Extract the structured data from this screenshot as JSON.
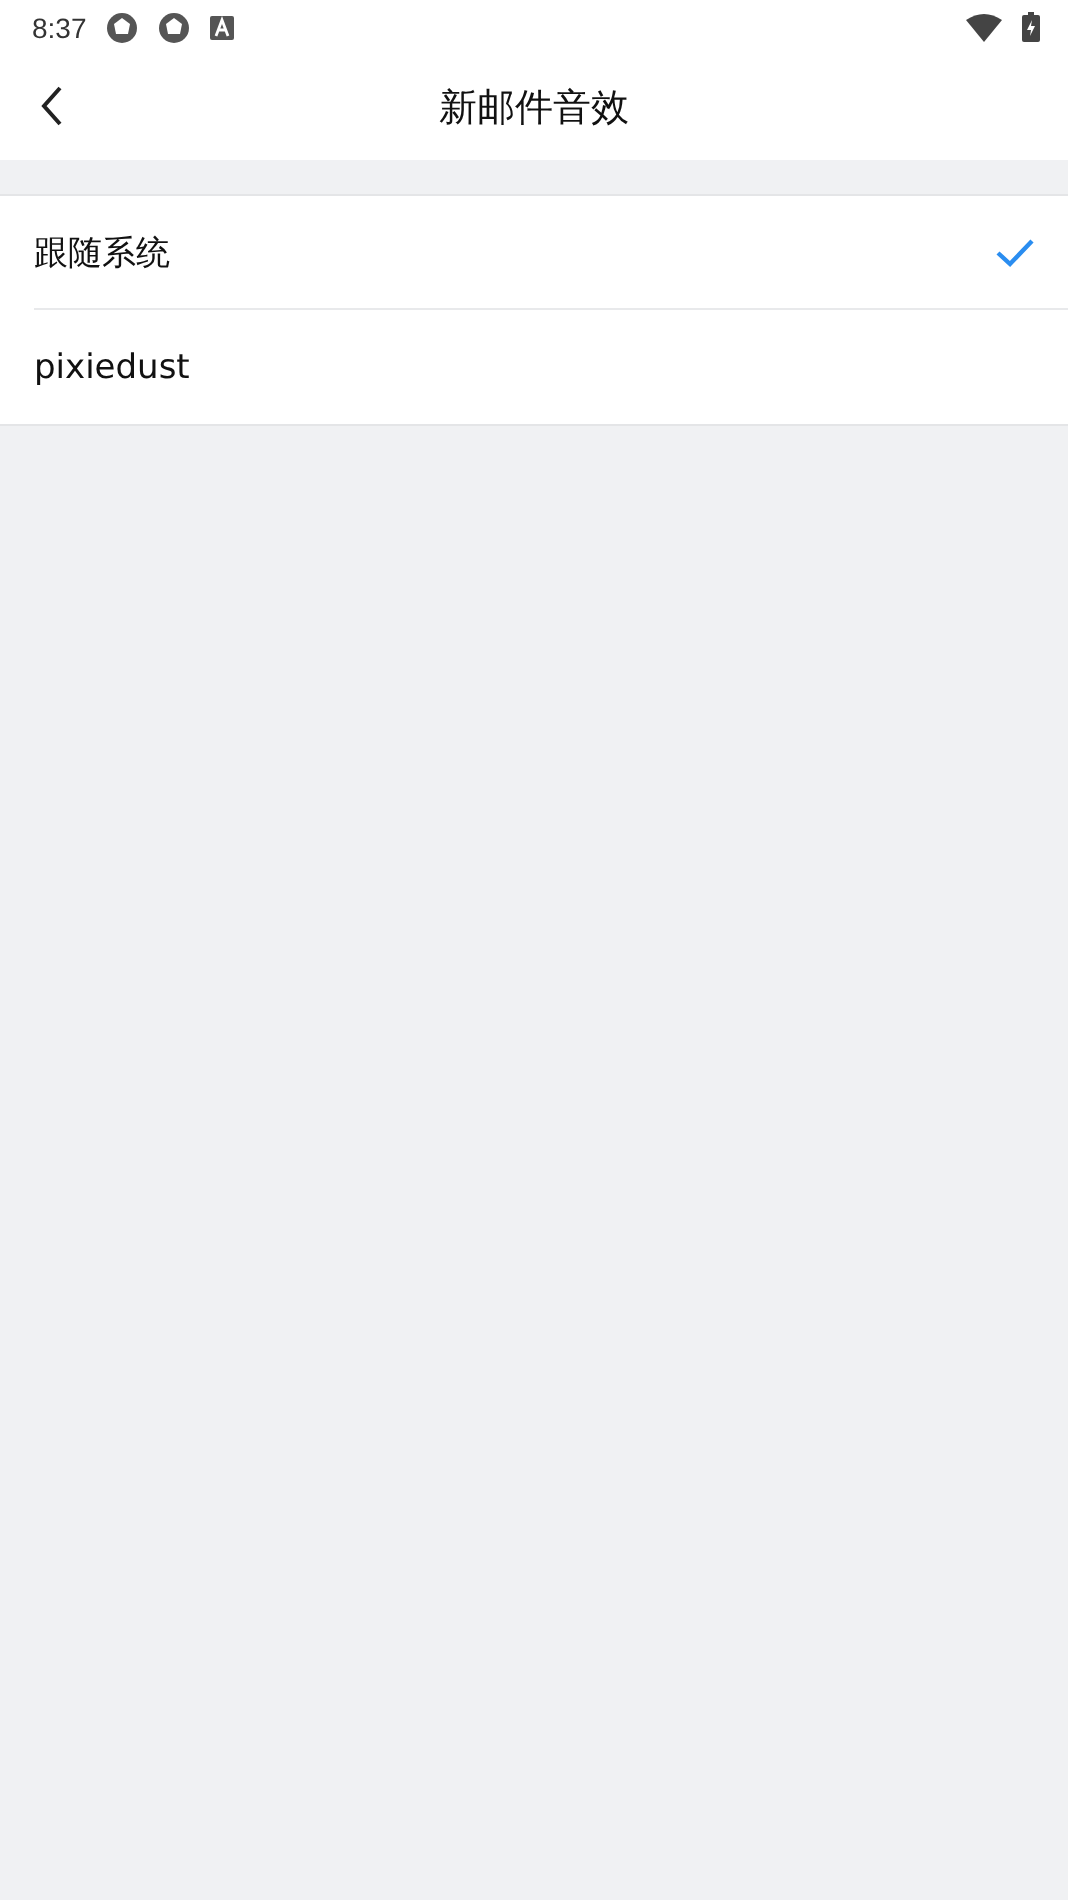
{
  "status_bar": {
    "time": "8:37"
  },
  "header": {
    "title": "新邮件音效"
  },
  "options": [
    {
      "label": "跟随系统",
      "selected": true
    },
    {
      "label": "pixiedust",
      "selected": false
    }
  ]
}
